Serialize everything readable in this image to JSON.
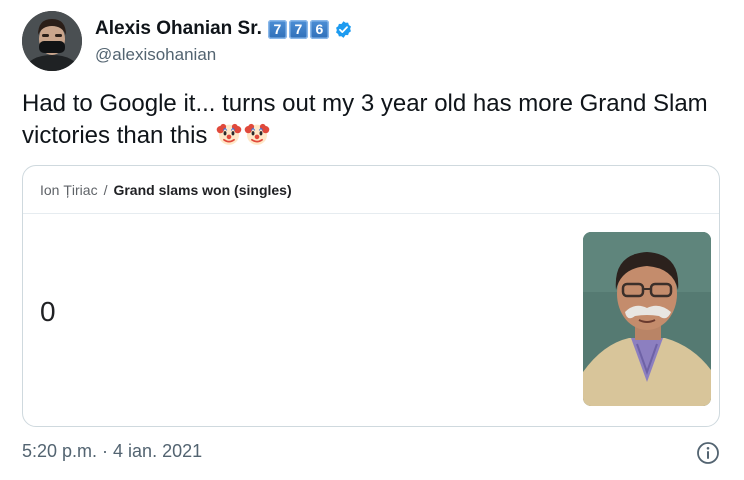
{
  "author": {
    "display_name": "Alexis Ohanian Sr.",
    "number_emojis": [
      "7",
      "7",
      "6"
    ],
    "verified": true,
    "handle": "@alexisohanian",
    "avatar_icon": "person-with-face-mask-avatar"
  },
  "tweet": {
    "text": "Had to Google it... turns out my 3 year old has more Grand Slam victories than this",
    "emojis": [
      "clown-face-emoji",
      "clown-face-emoji"
    ],
    "timestamp": "5:20 p.m. · 4 ian. 2021"
  },
  "card": {
    "breadcrumb_subject": "Ion Țiriac",
    "breadcrumb_separator": "/",
    "breadcrumb_attribute": "Grand slams won (singles)",
    "value": "0",
    "photo_icon": "portrait-photo"
  },
  "colors": {
    "verified_badge": "#1d9bf0",
    "keycap": "#3a7cc6",
    "muted_text": "#536471",
    "card_border": "#cfd9de"
  }
}
